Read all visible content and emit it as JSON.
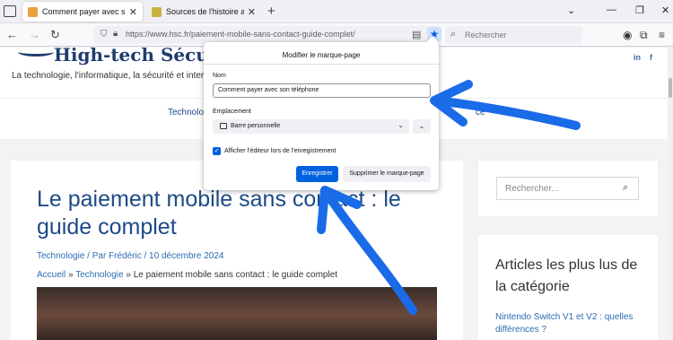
{
  "browser": {
    "tabs": [
      {
        "label": "Comment payer avec son télépho",
        "active": true,
        "favicon_color": "#e8a23a"
      },
      {
        "label": "Sources de l'histoire africaine au",
        "active": false,
        "favicon_color": "#c9b23a"
      }
    ],
    "url": "https://www.hsc.fr/paiement-mobile-sans-contact-guide-complet/",
    "search_placeholder": "Rechercher"
  },
  "bookmark_panel": {
    "title": "Modifier le marque-page",
    "name_label": "Nom",
    "name_value": "Comment payer avec son téléphone",
    "location_label": "Emplacement",
    "location_value": "Barre personnelle",
    "checkbox_label": "Afficher l'éditeur lors de l'enregistrement",
    "checkbox_checked": true,
    "save_label": "Enregistrer",
    "remove_label": "Supprimer le marque-page"
  },
  "site": {
    "logo_text": "High-tech Sécurité C",
    "tagline": "La technologie, l'informatique, la sécurité et interne",
    "social": [
      "in",
      "f"
    ],
    "menu": [
      "Technologie",
      "ce"
    ],
    "article": {
      "title": "Le paiement mobile sans contact : le guide complet",
      "meta": "Technologie / Par Frédéric / 10 décembre 2024",
      "breadcrumb_home": "Accueil",
      "breadcrumb_sep": "»",
      "breadcrumb_cat": "Technologie",
      "breadcrumb_current": "Le paiement mobile sans contact : le guide complet"
    },
    "sidebar": {
      "search_placeholder": "Rechercher...",
      "widget_title": "Articles les plus lus de la catégorie",
      "widget_link": "Nintendo Switch V1 et V2 : quelles différences ?"
    }
  },
  "colors": {
    "accent": "#0061e0",
    "annotation_arrow": "#1a6be8",
    "site_blue": "#1e4a87"
  }
}
